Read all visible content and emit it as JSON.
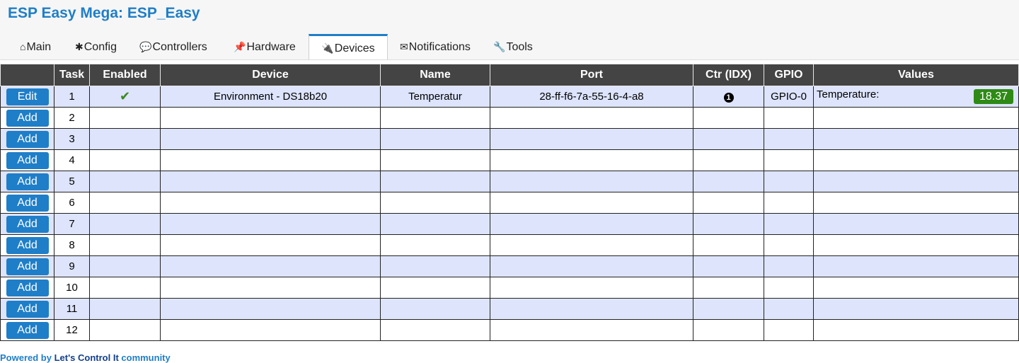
{
  "app": {
    "title": "ESP Easy Mega: ESP_Easy"
  },
  "tabs": [
    {
      "icon": "⌂",
      "label": "Main"
    },
    {
      "icon": "✱",
      "label": "Config"
    },
    {
      "icon": "💬",
      "label": "Controllers"
    },
    {
      "icon": "📌",
      "label": "Hardware"
    },
    {
      "icon": "🔌",
      "label": "Devices"
    },
    {
      "icon": "✉",
      "label": "Notifications"
    },
    {
      "icon": "🔧",
      "label": "Tools"
    }
  ],
  "active_tab": "Devices",
  "table": {
    "headers": [
      "",
      "Task",
      "Enabled",
      "Device",
      "Name",
      "Port",
      "Ctr (IDX)",
      "GPIO",
      "Values"
    ],
    "rows": [
      {
        "button": "Edit",
        "task": "1",
        "enabled": "✔",
        "device": "Environment - DS18b20",
        "name": "Temperatur",
        "port": "28-ff-f6-7a-55-16-4-a8",
        "ctr": "1",
        "gpio": "GPIO-0",
        "value_label": "Temperature:",
        "value": "18.37"
      },
      {
        "button": "Add",
        "task": "2"
      },
      {
        "button": "Add",
        "task": "3"
      },
      {
        "button": "Add",
        "task": "4"
      },
      {
        "button": "Add",
        "task": "5"
      },
      {
        "button": "Add",
        "task": "6"
      },
      {
        "button": "Add",
        "task": "7"
      },
      {
        "button": "Add",
        "task": "8"
      },
      {
        "button": "Add",
        "task": "9"
      },
      {
        "button": "Add",
        "task": "10"
      },
      {
        "button": "Add",
        "task": "11"
      },
      {
        "button": "Add",
        "task": "12"
      }
    ]
  },
  "footer": {
    "prefix": "Powered by ",
    "link": "Let's Control It",
    "suffix": " community"
  },
  "colors": {
    "accent": "#1f7ec8",
    "header_bg": "#444444",
    "row_alt": "#dde4fb",
    "value_badge": "#2e8a15"
  }
}
